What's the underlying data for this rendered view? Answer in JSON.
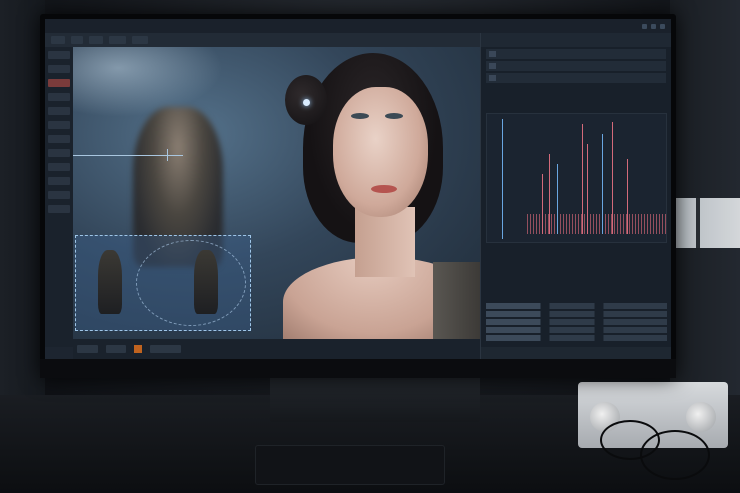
{
  "photo": {
    "subject": "",
    "palette": {
      "screen_bg": "#1d2530",
      "accent_blue": "#4aa8ff",
      "accent_orange": "#c0631f",
      "graph_red": "#d46a7a"
    }
  },
  "screen": {
    "menubar": {
      "items": [
        "",
        "",
        "",
        ""
      ]
    },
    "toolbar": {
      "items": [
        "",
        "",
        "",
        "",
        ""
      ]
    },
    "right_panel": {
      "header": "",
      "rows": [
        "",
        "",
        ""
      ],
      "status": [
        "",
        "",
        "",
        ""
      ]
    }
  }
}
